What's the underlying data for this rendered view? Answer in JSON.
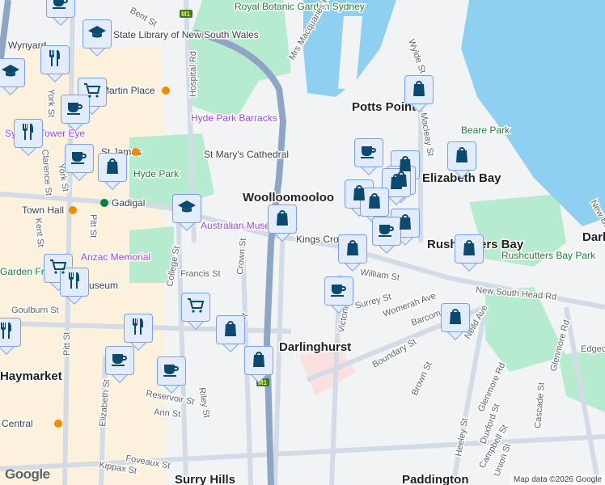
{
  "map": {
    "suburbs": [
      "Woolloomooloo",
      "Potts Point",
      "Elizabeth Bay",
      "Darlinghurst",
      "Surry Hills",
      "Paddington",
      "Haymarket",
      "Rushcutters Bay",
      "Darling",
      "Wynyard",
      "Central",
      "Kings Cross"
    ],
    "parks": [
      "Royal Botanic Garden Sydney",
      "Hyde Park",
      "Rushcutters Bay Park",
      "Beare Park",
      "Garden Friendship"
    ],
    "pois": [
      "State Library of New South Wales",
      "Hyde Park Barracks",
      "St Mary's Cathedral",
      "Australian Museum",
      "Sydney Tower Eye",
      "Anzac Memorial",
      "Museum"
    ],
    "stations": [
      "Martin Place",
      "St James",
      "Gadigal",
      "Town Hall",
      "Central"
    ],
    "streets": [
      "Bent St",
      "York St",
      "York St",
      "Clarence St",
      "Kent St",
      "Pitt St",
      "Pitt St",
      "Hospital Rd",
      "College St",
      "Crown St",
      "Francis St",
      "Elizabeth St",
      "Riley St",
      "Oxford St",
      "Reservoir St",
      "Ann St",
      "Foveaux St",
      "Kippax St",
      "Goulburn St",
      "William St",
      "New South Head Rd",
      "Surrey St",
      "Womerah Ave",
      "Barcom Ave",
      "Boundary St",
      "Neild Ave",
      "Victoria St",
      "Brown St",
      "Glenmore Rd",
      "Glenmore Rd",
      "Heeley St",
      "Duxford St",
      "Union St",
      "Cascade St",
      "Edgecliff Rd",
      "Mrs Macquaries Rd",
      "Wylde St",
      "Macleay St",
      "New Beach Rd",
      "Campbell St"
    ],
    "highway_shield": "M1",
    "logo": "Google",
    "attribution": "Map data ©2026 Google"
  },
  "markers": [
    {
      "type": "cafe"
    },
    {
      "type": "education"
    },
    {
      "type": "education"
    },
    {
      "type": "restaurant"
    },
    {
      "type": "shopping-cart"
    },
    {
      "type": "cafe"
    },
    {
      "type": "restaurant"
    },
    {
      "type": "cafe"
    },
    {
      "type": "shopping"
    },
    {
      "type": "education"
    },
    {
      "type": "shopping"
    },
    {
      "type": "shopping"
    },
    {
      "type": "cafe"
    },
    {
      "type": "shopping"
    },
    {
      "type": "shopping"
    },
    {
      "type": "shopping"
    },
    {
      "type": "shopping"
    },
    {
      "type": "shopping"
    },
    {
      "type": "shopping"
    },
    {
      "type": "shopping"
    },
    {
      "type": "cafe"
    },
    {
      "type": "shopping"
    },
    {
      "type": "shopping"
    },
    {
      "type": "shopping-cart"
    },
    {
      "type": "restaurant"
    },
    {
      "type": "cafe"
    },
    {
      "type": "shopping-cart"
    },
    {
      "type": "restaurant"
    },
    {
      "type": "shopping"
    },
    {
      "type": "shopping"
    },
    {
      "type": "restaurant"
    },
    {
      "type": "cafe"
    },
    {
      "type": "cafe"
    },
    {
      "type": "shopping"
    }
  ],
  "colors": {
    "water": "#8fd0f0",
    "park": "#a8e6c4",
    "road": "#c9d3e0",
    "highway": "#8ea6c4",
    "marker_fill": "#e3ecfd",
    "marker_icon": "#0b4a6e"
  }
}
